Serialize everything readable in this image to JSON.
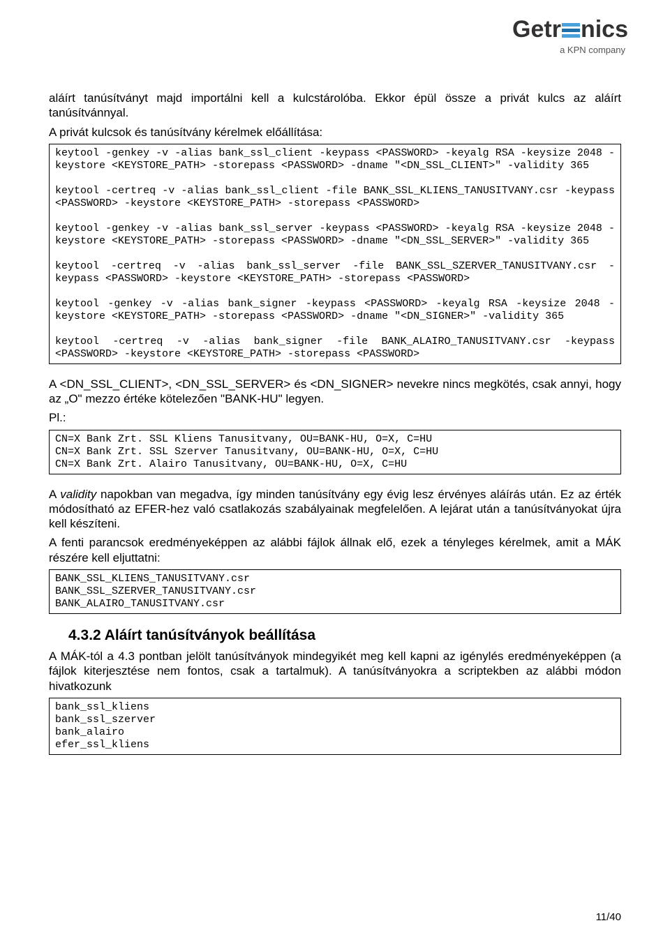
{
  "logo": {
    "name_left": "Getr",
    "name_right": "nics",
    "tagline": "a KPN company"
  },
  "intro": {
    "p1": "aláírt tanúsítványt majd importálni kell a kulcstárolóba. Ekkor épül össze a privát kulcs az aláírt tanúsítvánnyal.",
    "p2": "A privát kulcsok és tanúsítvány kérelmek előállítása:"
  },
  "code1": "keytool -genkey -v -alias bank_ssl_client -keypass <PASSWORD> -keyalg RSA -keysize 2048 -keystore <KEYSTORE_PATH> -storepass <PASSWORD> -dname \"<DN_SSL_CLIENT>\" -validity 365\n\nkeytool -certreq -v -alias bank_ssl_client -file BANK_SSL_KLIENS_TANUSITVANY.csr -keypass <PASSWORD> -keystore <KEYSTORE_PATH> -storepass <PASSWORD>\n\nkeytool -genkey -v -alias bank_ssl_server -keypass <PASSWORD> -keyalg RSA -keysize 2048 -keystore <KEYSTORE_PATH> -storepass <PASSWORD> -dname \"<DN_SSL_SERVER>\" -validity 365\n\nkeytool -certreq -v -alias bank_ssl_server -file BANK_SSL_SZERVER_TANUSITVANY.csr -keypass <PASSWORD> -keystore <KEYSTORE_PATH> -storepass <PASSWORD>\n\nkeytool -genkey -v -alias bank_signer -keypass <PASSWORD> -keyalg RSA -keysize 2048 -keystore <KEYSTORE_PATH> -storepass <PASSWORD> -dname \"<DN_SIGNER>\" -validity 365\n\nkeytool -certreq -v -alias bank_signer -file BANK_ALAIRO_TANUSITVANY.csr -keypass <PASSWORD> -keystore <KEYSTORE_PATH> -storepass <PASSWORD>",
  "mid": {
    "p1": "A <DN_SSL_CLIENT>, <DN_SSL_SERVER> és <DN_SIGNER> nevekre nincs megkötés, csak annyi, hogy az „O\" mezzo értéke kötelezően \"BANK-HU\" legyen.",
    "pl": "Pl.:"
  },
  "code2": "CN=X Bank Zrt. SSL Kliens Tanusitvany, OU=BANK-HU, O=X, C=HU\nCN=X Bank Zrt. SSL Szerver Tanusitvany, OU=BANK-HU, O=X, C=HU\nCN=X Bank Zrt. Alairo Tanusitvany, OU=BANK-HU, O=X, C=HU",
  "after2": {
    "p1a": "A ",
    "p1_italic": "validity",
    "p1b": " napokban van megadva, így minden tanúsítvány egy évig lesz érvényes aláírás után. Ez az érték módosítható az EFER-hez való csatlakozás szabályainak megfelelően. A lejárat után a tanúsítványokat újra kell készíteni.",
    "p2": "A fenti parancsok eredményeképpen az alábbi fájlok állnak elő, ezek a tényleges kérelmek, amit a MÁK részére kell eljuttatni:"
  },
  "code3": "BANK_SSL_KLIENS_TANUSITVANY.csr\nBANK_SSL_SZERVER_TANUSITVANY.csr\nBANK_ALAIRO_TANUSITVANY.csr",
  "section": {
    "heading": "4.3.2 Aláírt tanúsítványok beállítása",
    "p1": "A MÁK-tól a 4.3 pontban jelölt tanúsítványok mindegyikét meg kell kapni az igénylés eredményeképpen (a fájlok kiterjesztése nem fontos, csak a tartalmuk). A tanúsítványokra a scriptekben az alábbi módon hivatkozunk"
  },
  "code4": "bank_ssl_kliens\nbank_ssl_szerver\nbank_alairo\nefer_ssl_kliens",
  "pagenum": "11/40"
}
